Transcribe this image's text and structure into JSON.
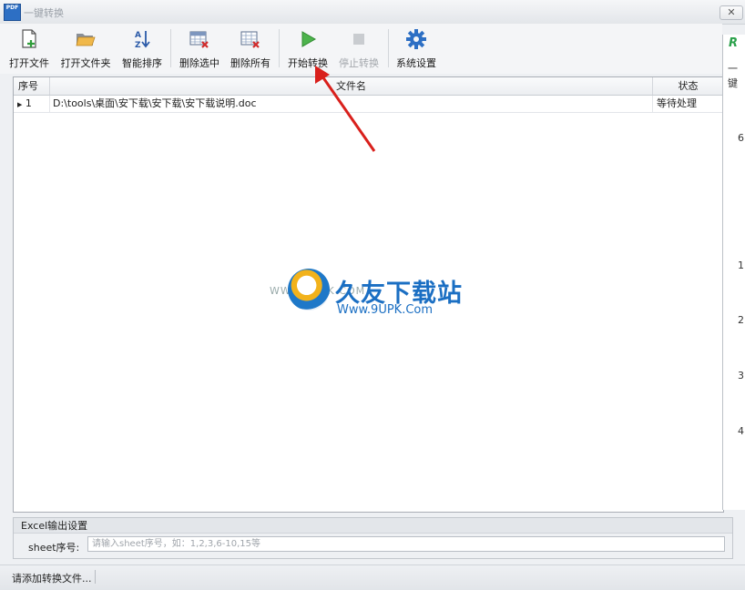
{
  "window": {
    "title": "一键转换",
    "icon_text": "PDF",
    "close_label": "✕"
  },
  "toolbar": [
    {
      "label": "打开文件",
      "icon": "open-file-icon"
    },
    {
      "label": "打开文件夹",
      "icon": "open-folder-icon"
    },
    {
      "label": "智能排序",
      "icon": "sort-az-icon"
    },
    {
      "label": "删除选中",
      "icon": "delete-selected-icon"
    },
    {
      "label": "删除所有",
      "icon": "delete-all-icon"
    },
    {
      "label": "开始转换",
      "icon": "play-icon"
    },
    {
      "label": "停止转换",
      "icon": "stop-icon",
      "disabled": true
    },
    {
      "label": "系统设置",
      "icon": "gear-icon"
    }
  ],
  "grid": {
    "columns": [
      "序号",
      "文件名",
      "状态"
    ],
    "rows": [
      {
        "index": "1",
        "filename": "D:\\tools\\桌面\\安下载\\安下载\\安下载说明.doc",
        "status": "等待处理"
      }
    ]
  },
  "watermark": {
    "cn": "久友下载站",
    "en": "Www.9UPK.Com",
    "www": "WWW.9UPK.COM"
  },
  "excel": {
    "title": "Excel输出设置",
    "sheet_label": "sheet序号:",
    "sheet_placeholder": "请输入sheet序号，如：1,2,3,6-10,15等"
  },
  "status_bar": {
    "text": "请添加转换文件..."
  },
  "background_window": {
    "title_glyph": "R",
    "line": "一键",
    "numbers": [
      "6",
      "1",
      "2",
      "3",
      "4"
    ]
  },
  "colors": {
    "accent": "#1b6fc3",
    "arrow": "#d9201c",
    "play": "#3aa53a"
  }
}
